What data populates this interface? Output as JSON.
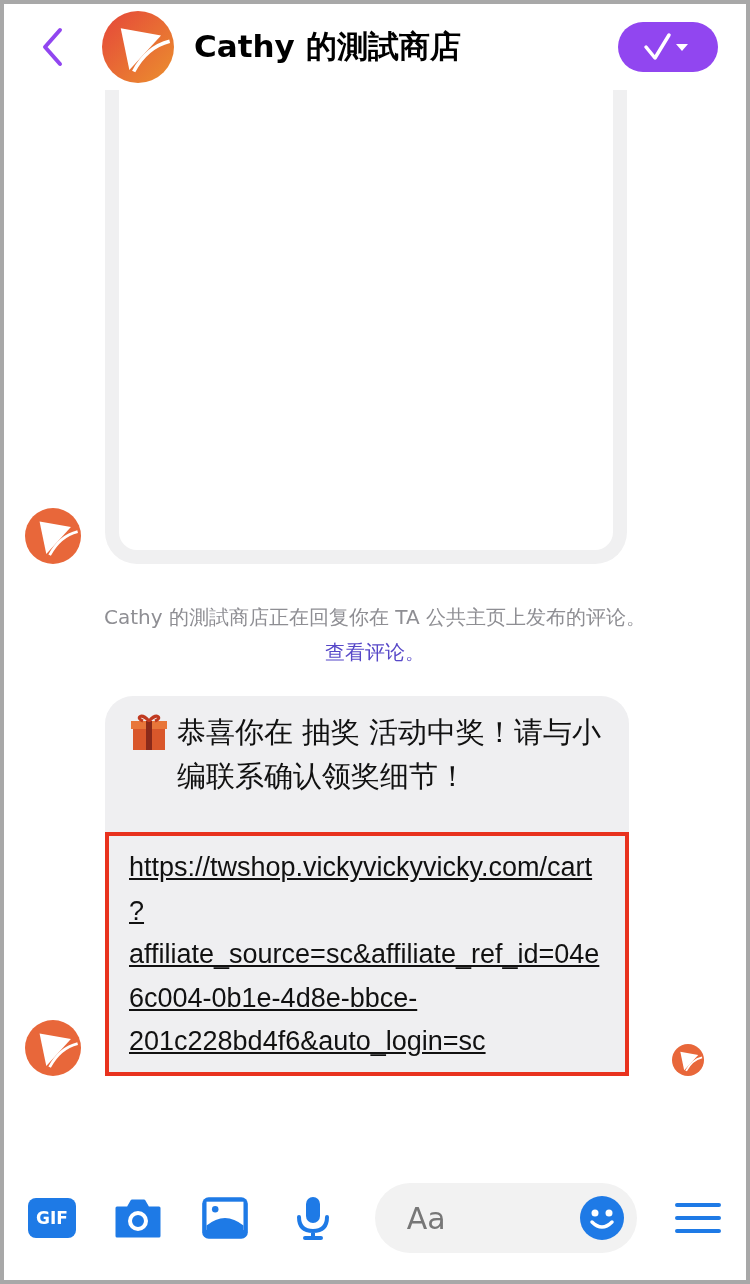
{
  "header": {
    "title": "Cathy 的測試商店"
  },
  "messages": [
    {
      "kind": "card",
      "avatar": true
    },
    {
      "kind": "notice",
      "text": "Cathy 的測試商店正在回复你在 TA 公共主页上发布的评论。",
      "link": "查看评论。"
    },
    {
      "kind": "text",
      "avatar": true,
      "text": "恭喜你在 抽奖 活动中奖！请与小编联系确认领奖细节！",
      "link": "https://twshop.vickyvickyvicky.com/cart?affiliate_source=sc&affiliate_ref_id=04e6c004-0b1e-4d8e-bbce-201c228bd4f6&auto_login=sc",
      "highlighted": true,
      "seen": true
    }
  ],
  "composer": {
    "gif_label": "GIF",
    "placeholder": "Aa"
  }
}
